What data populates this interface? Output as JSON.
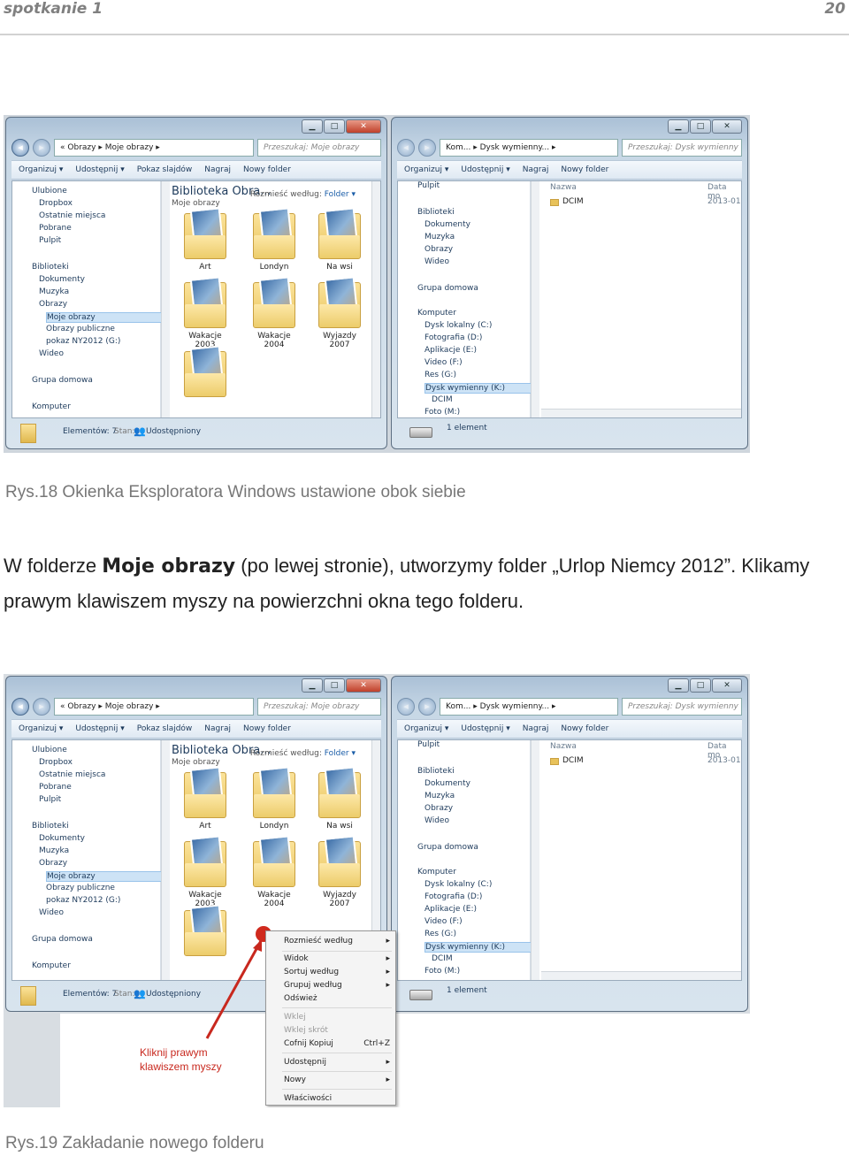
{
  "header": {
    "section": "spotkanie 1",
    "page": "20"
  },
  "figure1": {
    "left_window": {
      "address": [
        "«",
        "Obrazy",
        "▸",
        "Moje obrazy",
        "▸"
      ],
      "search": "Przeszukaj: Moje obrazy",
      "toolbar": [
        "Organizuj ▾",
        "Udostępnij ▾",
        "Pokaz slajdów",
        "Nagraj",
        "Nowy folder"
      ],
      "tree": [
        "Ulubione",
        "Dropbox",
        "Ostatnie miejsca",
        "Pobrane",
        "Pulpit",
        "Biblioteki",
        "Dokumenty",
        "Muzyka",
        "Obrazy",
        "Moje obrazy",
        "Obrazy publiczne",
        "pokaz NY2012 (G:)",
        "Wideo",
        "Grupa domowa",
        "Komputer"
      ],
      "library_title": "Biblioteka Obra...",
      "library_sub": "Moje obrazy",
      "arrange_label": "Rozmieść według:",
      "arrange_value": "Folder ▾",
      "folders": [
        "Art",
        "Londyn",
        "Na wsi",
        "Wakacje 2003",
        "Wakacje 2004",
        "Wyjazdy 2007",
        ""
      ],
      "status": "Elementów: 7",
      "status_state": "Stan:",
      "status_shared": "Udostępniony"
    },
    "right_window": {
      "address": [
        "Kom...",
        "▸",
        "Dysk wymienny...",
        "▸"
      ],
      "search": "Przeszukaj: Dysk wymienny (K:)",
      "toolbar": [
        "Organizuj ▾",
        "Udostępnij ▾",
        "Nagraj",
        "Nowy folder"
      ],
      "tree": [
        "Pulpit",
        "Biblioteki",
        "Dokumenty",
        "Muzyka",
        "Obrazy",
        "Wideo",
        "Grupa domowa",
        "Komputer",
        "Dysk lokalny (C:)",
        "Fotografia (D:)",
        "Aplikacje (E:)",
        "Video (F:)",
        "Res (G:)",
        "Dysk wymienny (K:)",
        "DCIM",
        "Foto (M:)"
      ],
      "col_name": "Nazwa",
      "col_date": "Data mo",
      "item": "DCIM",
      "item_date": "2013-01",
      "status": "1 element"
    }
  },
  "caption1": "Rys.18 Okienka Eksploratora Windows ustawione obok siebie",
  "body": {
    "p1": "W folderze ",
    "bold": "Moje obrazy",
    "p2": " (po lewej stronie), utworzymy folder „Urlop Niemcy 2012”. Klikamy prawym klawiszem myszy na powierzchni okna tego folderu."
  },
  "figure2": {
    "context_menu": [
      "Rozmieść według",
      "Widok",
      "Sortuj według",
      "Grupuj według",
      "Odśwież",
      "Wklej",
      "Wklej skrót",
      "Cofnij Kopiuj",
      "Udostępnij",
      "Nowy",
      "Właściwości"
    ],
    "undo_shortcut": "Ctrl+Z",
    "annotation": [
      "Kliknij prawym",
      "klawiszem myszy"
    ]
  },
  "caption2": "Rys.19 Zakładanie nowego folderu"
}
